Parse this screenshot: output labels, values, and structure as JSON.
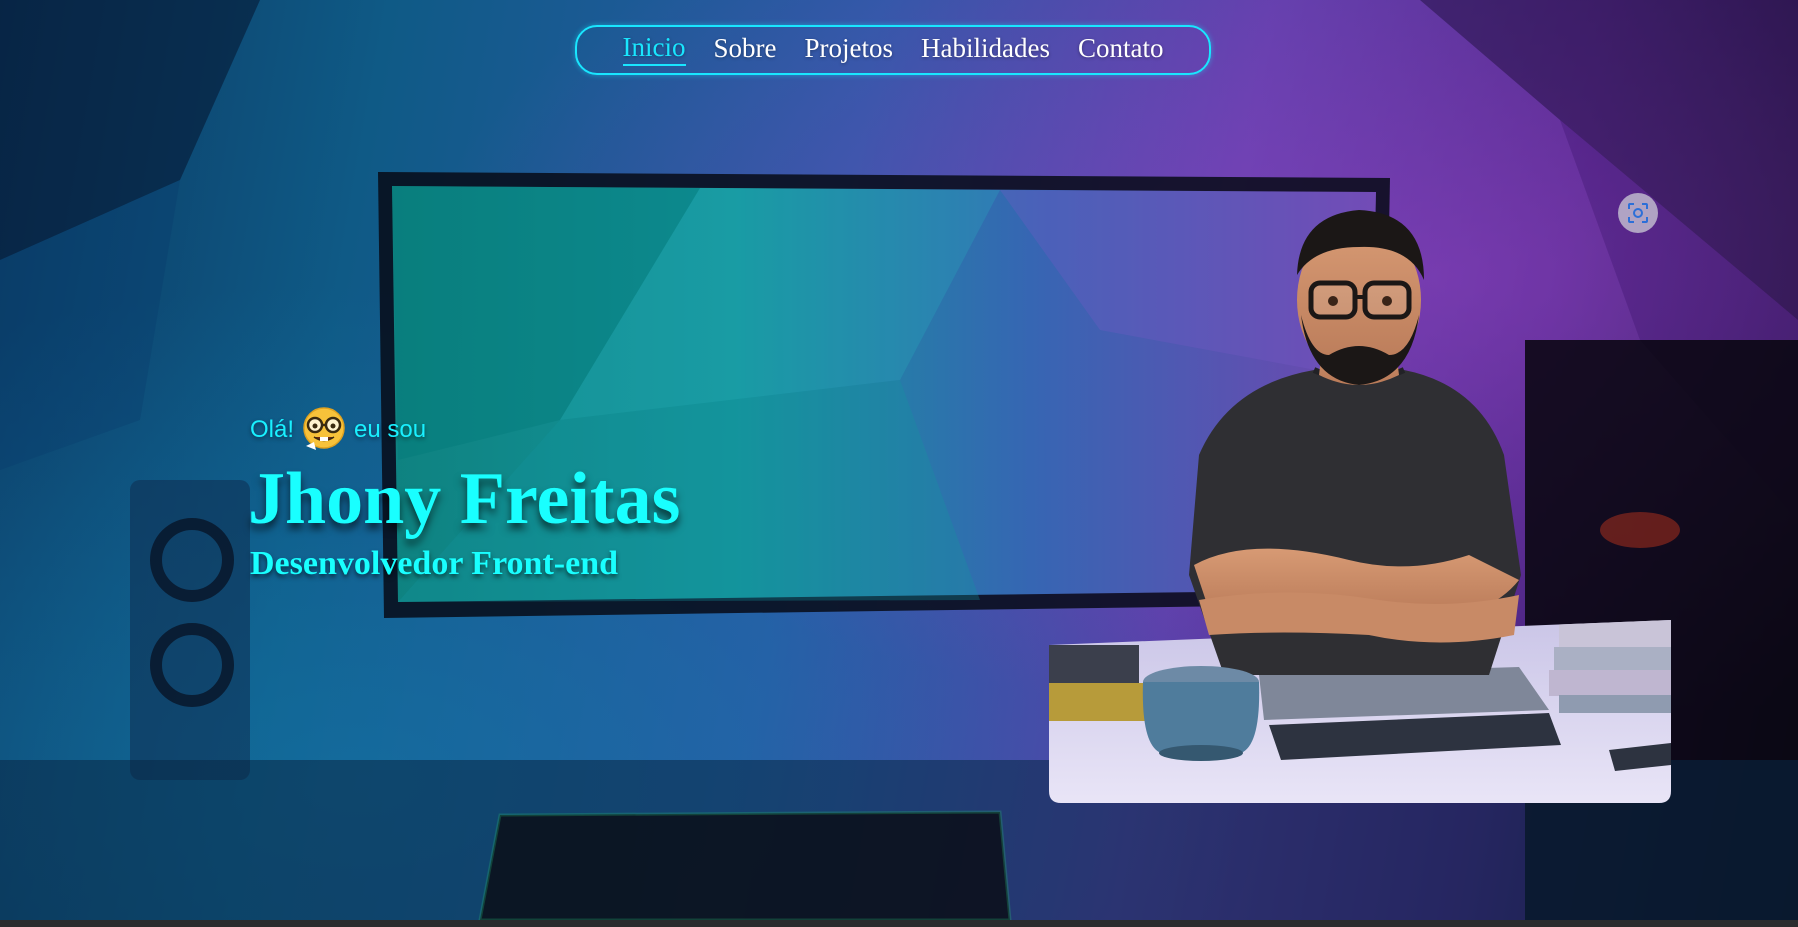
{
  "nav": {
    "items": [
      {
        "label": "Inicio",
        "active": true
      },
      {
        "label": "Sobre",
        "active": false
      },
      {
        "label": "Projetos",
        "active": false
      },
      {
        "label": "Habilidades",
        "active": false
      },
      {
        "label": "Contato",
        "active": false
      }
    ]
  },
  "hero": {
    "greeting_prefix": "Olá!",
    "greeting_icon": "nerd-face-emoji",
    "greeting_suffix": "eu sou",
    "name": "Jhony Freitas",
    "role": "Desenvolvedor Front-end"
  },
  "portrait": {
    "image": "3d-avatar-man-with-glasses-at-desk",
    "overlay_button_icon": "scan-icon"
  },
  "colors": {
    "accent": "#19e6ff",
    "heading": "#19ffff",
    "nav_text": "#ffffff"
  }
}
